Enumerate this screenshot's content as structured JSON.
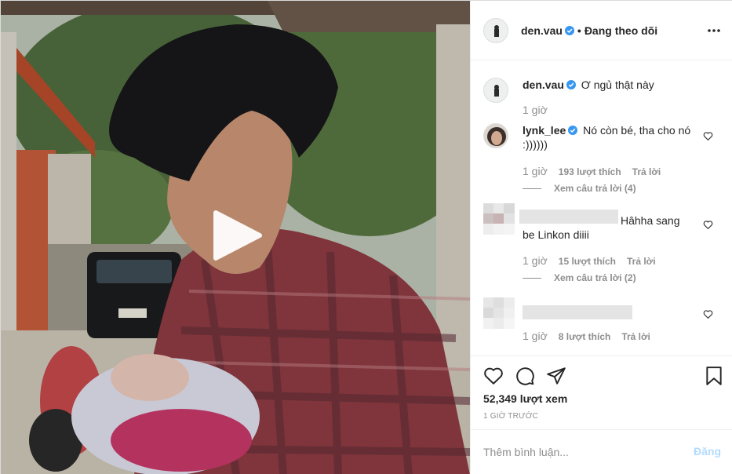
{
  "post": {
    "author": "den.vau",
    "separator": "•",
    "follow_status": "Đang theo dõi",
    "more_icon": "more-horizontal-icon"
  },
  "caption": {
    "author": "den.vau",
    "text": "Ơ ngủ thật này",
    "time": "1 giờ"
  },
  "comments": [
    {
      "author": "lynk_lee",
      "verified": true,
      "text_line1": "Nó còn bé, tha cho nó",
      "text_line2": ":))))))",
      "time": "1 giờ",
      "likes": "193 lượt thích",
      "reply": "Trả lời",
      "view_replies": "Xem câu trả lời (4)"
    },
    {
      "author_blurred": true,
      "text_line1": "Hâhha sang",
      "text_line2": "be Linkon diiii",
      "time": "1 giờ",
      "likes": "15 lượt thích",
      "reply": "Trả lời",
      "view_replies": "Xem câu trả lời (2)"
    },
    {
      "author_blurred": true,
      "time": "1 giờ",
      "likes": "8 lượt thích",
      "reply": "Trả lời"
    }
  ],
  "stats": {
    "views": "52,349 lượt xem",
    "ago": "1 GIỜ TRƯỚC"
  },
  "composer": {
    "placeholder": "Thêm bình luận...",
    "post_label": "Đăng"
  },
  "colors": {
    "verified_blue": "#3897f0",
    "muted_text": "#8e8e8e",
    "post_button_disabled": "#b3dbff",
    "border": "#efefef"
  }
}
